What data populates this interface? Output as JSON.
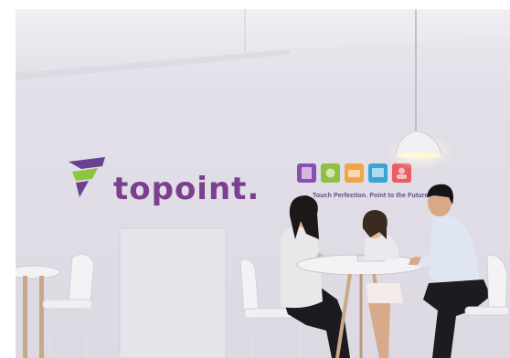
{
  "image": {
    "kind": "photo",
    "scene": "office-meeting"
  },
  "wall_sign": {
    "brand_text": "topoint.",
    "tagline": "Touch Perfection. Point to the Future.",
    "icon_tiles": [
      {
        "icon": "purple-tile",
        "color": "#8c4fb0"
      },
      {
        "icon": "green-tile",
        "color": "#8fbf45"
      },
      {
        "icon": "orange-tile",
        "color": "#f3a447"
      },
      {
        "icon": "blue-tile",
        "color": "#3aa4d7"
      },
      {
        "icon": "red-tile",
        "color": "#ea5c63"
      }
    ],
    "brand_colors": {
      "text": "#7a3f8d",
      "icon_green": "#8cc63f",
      "icon_purple": "#6b3f92"
    }
  }
}
